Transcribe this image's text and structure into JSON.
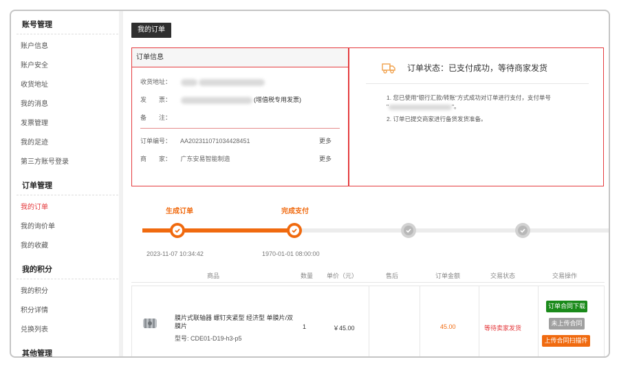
{
  "sidebar": {
    "groups": [
      {
        "title": "账号管理",
        "items": [
          "账户信息",
          "账户安全",
          "收货地址",
          "我的消息",
          "发票管理",
          "我的足迹",
          "第三方账号登录"
        ]
      },
      {
        "title": "订单管理",
        "items": [
          "我的订单",
          "我的询价单",
          "我的收藏"
        ]
      },
      {
        "title": "我的积分",
        "items": [
          "我的积分",
          "积分详情",
          "兑换列表"
        ]
      },
      {
        "title": "其他管理",
        "items": []
      }
    ],
    "active_item": "我的订单"
  },
  "tab": {
    "label": "我的订单"
  },
  "order_info": {
    "header": "订单信息",
    "address_label": "收货地址：",
    "invoice_label": "发　　票：",
    "invoice_suffix": "(增值税专用发票)",
    "remark_label": "备　　注：",
    "order_no_label": "订单编号：",
    "order_no": "AA202311071034428451",
    "merchant_label": "商　　家：",
    "merchant": "广东安易智能制造",
    "more_1": "更多",
    "more_2": "更多"
  },
  "status": {
    "title": "订单状态：已支付成功，等待商家发货",
    "note_1a": "1. 您已使用\"银行汇款/转账\"方式成功对订单进行支付，支付单号",
    "note_1b": "\"",
    "note_1c": "\"。",
    "note_2": "2. 订单已提交商家进行备货发货准备。"
  },
  "progress": {
    "steps": [
      {
        "label": "生成订单",
        "time": "2023-11-07 10:34:42",
        "done": true
      },
      {
        "label": "完成支付",
        "time": "1970-01-01 08:00:00",
        "done": true
      },
      {
        "label": "",
        "time": "",
        "done": false
      },
      {
        "label": "",
        "time": "",
        "done": false
      }
    ]
  },
  "table": {
    "headers": [
      "商品",
      "数量",
      "单价（元）",
      "售后",
      "订单金额",
      "交易状态",
      "交易操作"
    ],
    "row": {
      "name": "膜片式联轴器 螺钉夹紧型 经济型 单膜片/双膜片",
      "model": "型号: CDE01-D19-h3-p5",
      "quantity": "1",
      "unit_price": "￥45.00",
      "after_sale": "",
      "amount": "45.00",
      "status": "等待卖家发货",
      "actions": [
        "订单合同下载",
        "未上传合同",
        "上传合同扫描件"
      ]
    }
  },
  "colors": {
    "accent": "#e4393c",
    "orange": "#f06a0f",
    "green": "#1a8a1a",
    "gray": "#a0a0a0"
  }
}
